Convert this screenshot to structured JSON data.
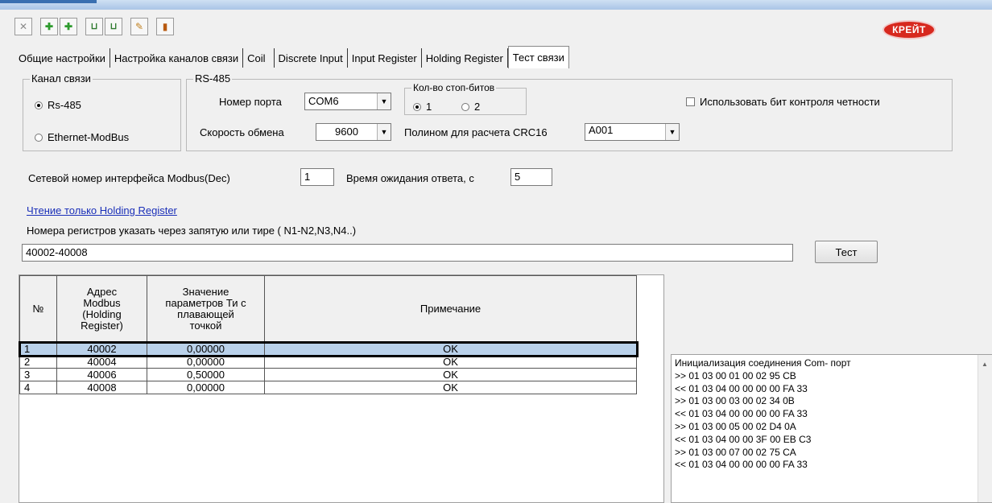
{
  "toolbar": {
    "buttons": [
      "delete-icon",
      "add-row-icon",
      "add-row-2-icon",
      "import-icon",
      "export-icon",
      "edit-icon",
      "exit-icon"
    ]
  },
  "logo": {
    "text": "КРЕЙТ"
  },
  "tabs": [
    "Общие настройки",
    "Настройка каналов связи",
    "Coil",
    "Discrete Input",
    "Input Register",
    "Holding Register",
    "Тест связи"
  ],
  "channel": {
    "legend": "Канал связи",
    "rs485": "Rs-485",
    "ethernet": "Ethernet-ModBus",
    "selected": "Rs-485"
  },
  "rs485": {
    "legend": "RS-485",
    "port_label": "Номер порта",
    "port_value": "COM6",
    "speed_label": "Скорость обмена",
    "speed_value": "9600",
    "stopbits_legend": "Кол-во стоп-битов",
    "stopbit1": "1",
    "stopbit2": "2",
    "crc_label": "Полином для расчета CRC16",
    "crc_value": "A001",
    "parity_label": "Использовать бит контроля четности"
  },
  "network": {
    "address_label": "Сетевой номер интерфейса Modbus(Dec)",
    "address_value": "1",
    "timeout_label": "Время ожидания ответа, с",
    "timeout_value": "5"
  },
  "read_link": "Чтение только Holding Register",
  "registers": {
    "label": "Номера регистров указать через запятую или тире ( N1-N2,N3,N4..)",
    "value": "40002-40008"
  },
  "test_button": "Тест",
  "table": {
    "headers": {
      "num": "№",
      "address_1": "Адрес",
      "address_2": "Modbus",
      "address_3": "(Holding",
      "address_4": "Register)",
      "value_1": "Значение",
      "value_2": "параметров Ти с",
      "value_3": "плавающей",
      "value_4": "точкой",
      "note": "Примечание"
    },
    "rows": [
      {
        "n": "1",
        "addr": "40002",
        "val": "0,00000",
        "note": "OK"
      },
      {
        "n": "2",
        "addr": "40004",
        "val": "0,00000",
        "note": "OK"
      },
      {
        "n": "3",
        "addr": "40006",
        "val": "0,50000",
        "note": "OK"
      },
      {
        "n": "4",
        "addr": "40008",
        "val": "0,00000",
        "note": "OK"
      }
    ]
  },
  "log": [
    "Инициализация соединения Com- порт",
    ">> 01 03 00 01 00 02 95 CB",
    "<< 01 03 04 00 00 00 00 FA 33",
    ">> 01 03 00 03 00 02 34 0B",
    "<< 01 03 04 00 00 00 00 FA 33",
    ">> 01 03 00 05 00 02 D4 0A",
    "<< 01 03 04 00 00 3F 00 EB C3",
    ">> 01 03 00 07 00 02 75 CA",
    "<< 01 03 04 00 00 00 00 FA 33"
  ]
}
